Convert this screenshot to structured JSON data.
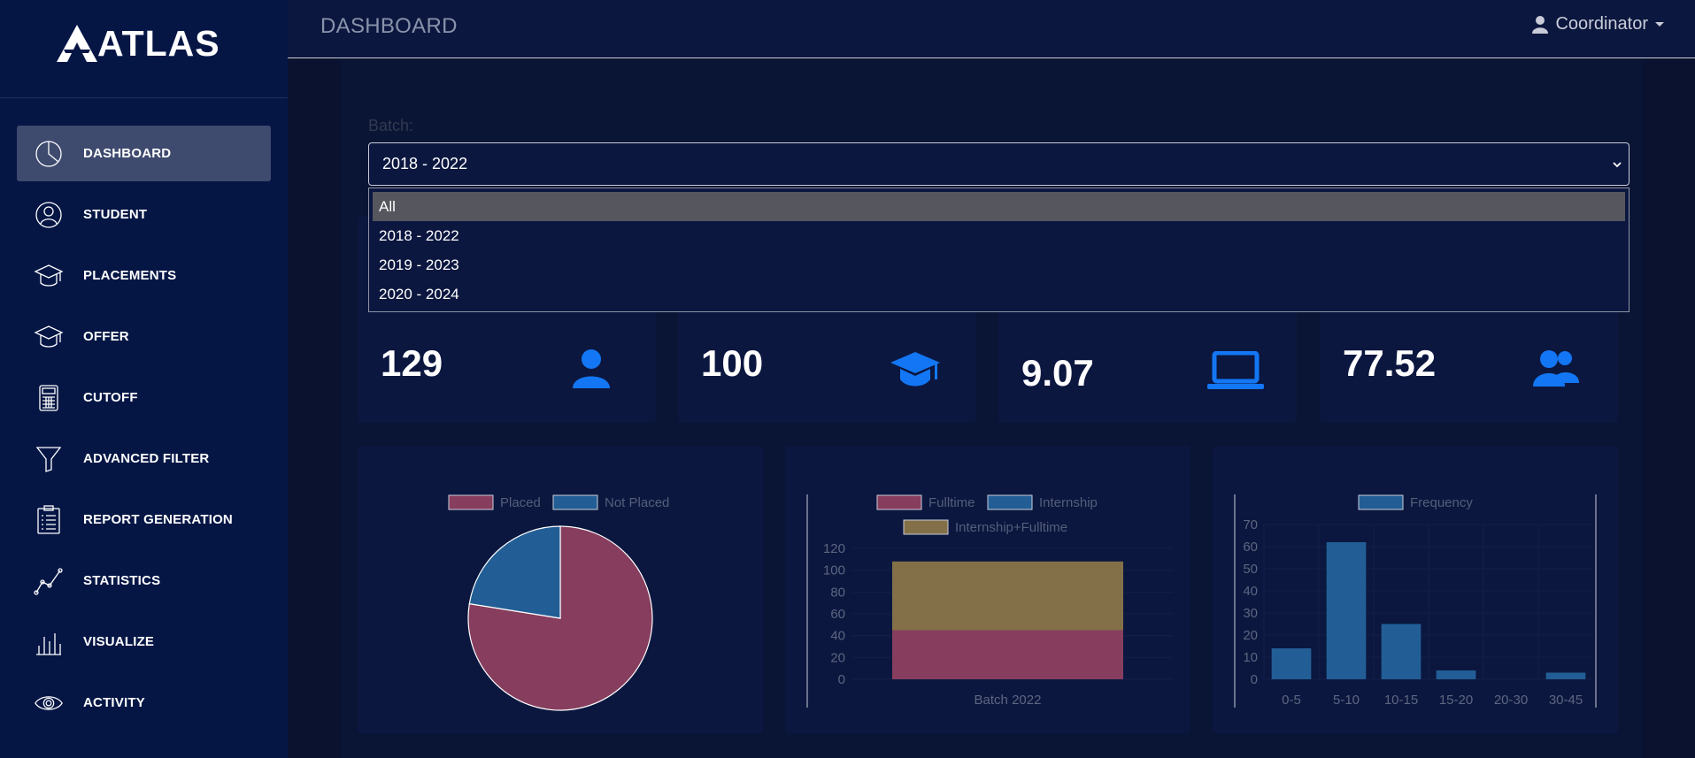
{
  "app": {
    "name": "ATLAS"
  },
  "header": {
    "title": "DASHBOARD",
    "user": "Coordinator"
  },
  "sidebar": {
    "items": [
      {
        "label": "DASHBOARD",
        "icon": "pie-chart-icon",
        "active": true
      },
      {
        "label": "STUDENT",
        "icon": "user-icon"
      },
      {
        "label": "PLACEMENTS",
        "icon": "graduation-cap-icon"
      },
      {
        "label": "OFFER",
        "icon": "graduation-cap-icon"
      },
      {
        "label": "CUTOFF",
        "icon": "calculator-icon"
      },
      {
        "label": "ADVANCED FILTER",
        "icon": "filter-icon"
      },
      {
        "label": "REPORT GENERATION",
        "icon": "clipboard-icon"
      },
      {
        "label": "STATISTICS",
        "icon": "line-chart-icon"
      },
      {
        "label": "VISUALIZE",
        "icon": "bar-chart-icon"
      },
      {
        "label": "ACTIVITY",
        "icon": "eye-icon"
      }
    ]
  },
  "filter": {
    "label": "Batch:",
    "selected": "2018 - 2022",
    "options": [
      "All",
      "2018 - 2022",
      "2019 - 2023",
      "2020 - 2024"
    ],
    "highlighted": "All"
  },
  "stats": [
    {
      "value": "129",
      "icon": "user-icon"
    },
    {
      "value": "100",
      "icon": "graduation-cap-icon"
    },
    {
      "value": "9.07",
      "icon": "laptop-icon"
    },
    {
      "value": "77.52",
      "icon": "users-icon"
    }
  ],
  "colors": {
    "accent": "#1377f5",
    "placed": "#873d5e",
    "not_placed": "#225e95",
    "internship_fulltime": "#837048"
  },
  "chart_data": [
    {
      "type": "pie",
      "legend": [
        "Placed",
        "Not Placed"
      ],
      "values": [
        100,
        29
      ],
      "colors": [
        "#873d5e",
        "#225e95"
      ],
      "legend_position": "top"
    },
    {
      "type": "bar",
      "stacked": true,
      "categories": [
        "Batch 2022"
      ],
      "series": [
        {
          "name": "Fulltime",
          "values": [
            45
          ],
          "color": "#873d5e"
        },
        {
          "name": "Internship",
          "values": [
            0
          ],
          "color": "#225e95"
        },
        {
          "name": "Internship+Fulltime",
          "values": [
            63
          ],
          "color": "#837048"
        }
      ],
      "ylim": [
        0,
        120
      ],
      "yticks": [
        0,
        20,
        40,
        60,
        80,
        100,
        120
      ],
      "legend_position": "top"
    },
    {
      "type": "bar",
      "categories": [
        "0-5",
        "5-10",
        "10-15",
        "15-20",
        "20-30",
        "30-45"
      ],
      "series": [
        {
          "name": "Frequency",
          "values": [
            14,
            62,
            25,
            4,
            0,
            3
          ],
          "color": "#225e95"
        }
      ],
      "ylim": [
        0,
        70
      ],
      "yticks": [
        0,
        10,
        20,
        30,
        40,
        50,
        60,
        70
      ],
      "legend_position": "top"
    }
  ]
}
